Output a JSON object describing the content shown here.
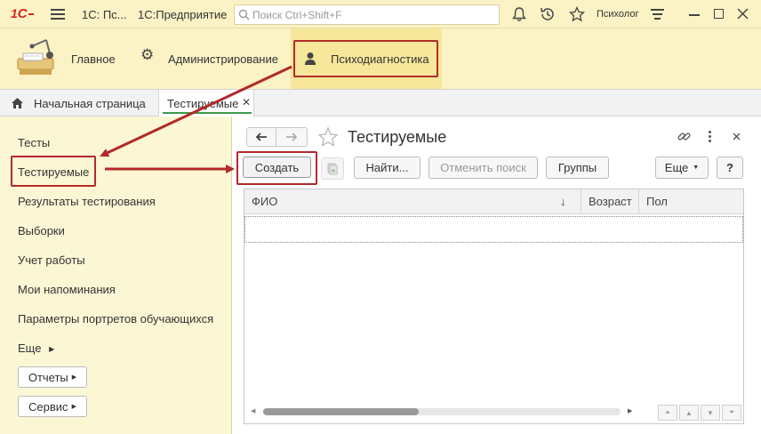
{
  "titlebar": {
    "app_title": "1С: Пс...",
    "app_name": "1С:Предприятие",
    "search_placeholder": "Поиск Ctrl+Shift+F",
    "user": "Психолог"
  },
  "sections": [
    {
      "label": "Главное"
    },
    {
      "label": "Администрирование"
    },
    {
      "label": "Психодиагностика"
    }
  ],
  "tabs": {
    "home": "Начальная страница",
    "active": "Тестируемые",
    "close": "✕"
  },
  "nav": {
    "items": [
      "Тесты",
      "Тестируемые",
      "Результаты тестирования",
      "Выборки",
      "Учет работы",
      "Мои напоминания",
      "Параметры портретов обучающихся"
    ],
    "more": "Еще",
    "reports": "Отчеты",
    "service": "Сервис"
  },
  "form": {
    "title": "Тестируемые",
    "toolbar": {
      "create": "Создать",
      "find": "Найти...",
      "cancel_search": "Отменить поиск",
      "groups": "Группы",
      "more": "Еще",
      "help": "?"
    },
    "columns": [
      "ФИО",
      "Возраст",
      "Пол"
    ],
    "sort_indicator": "↓"
  },
  "colors": {
    "accent_red": "#b22a2a",
    "header_yellow": "#fbf2c5",
    "nav_yellow": "#fbf7d5"
  }
}
